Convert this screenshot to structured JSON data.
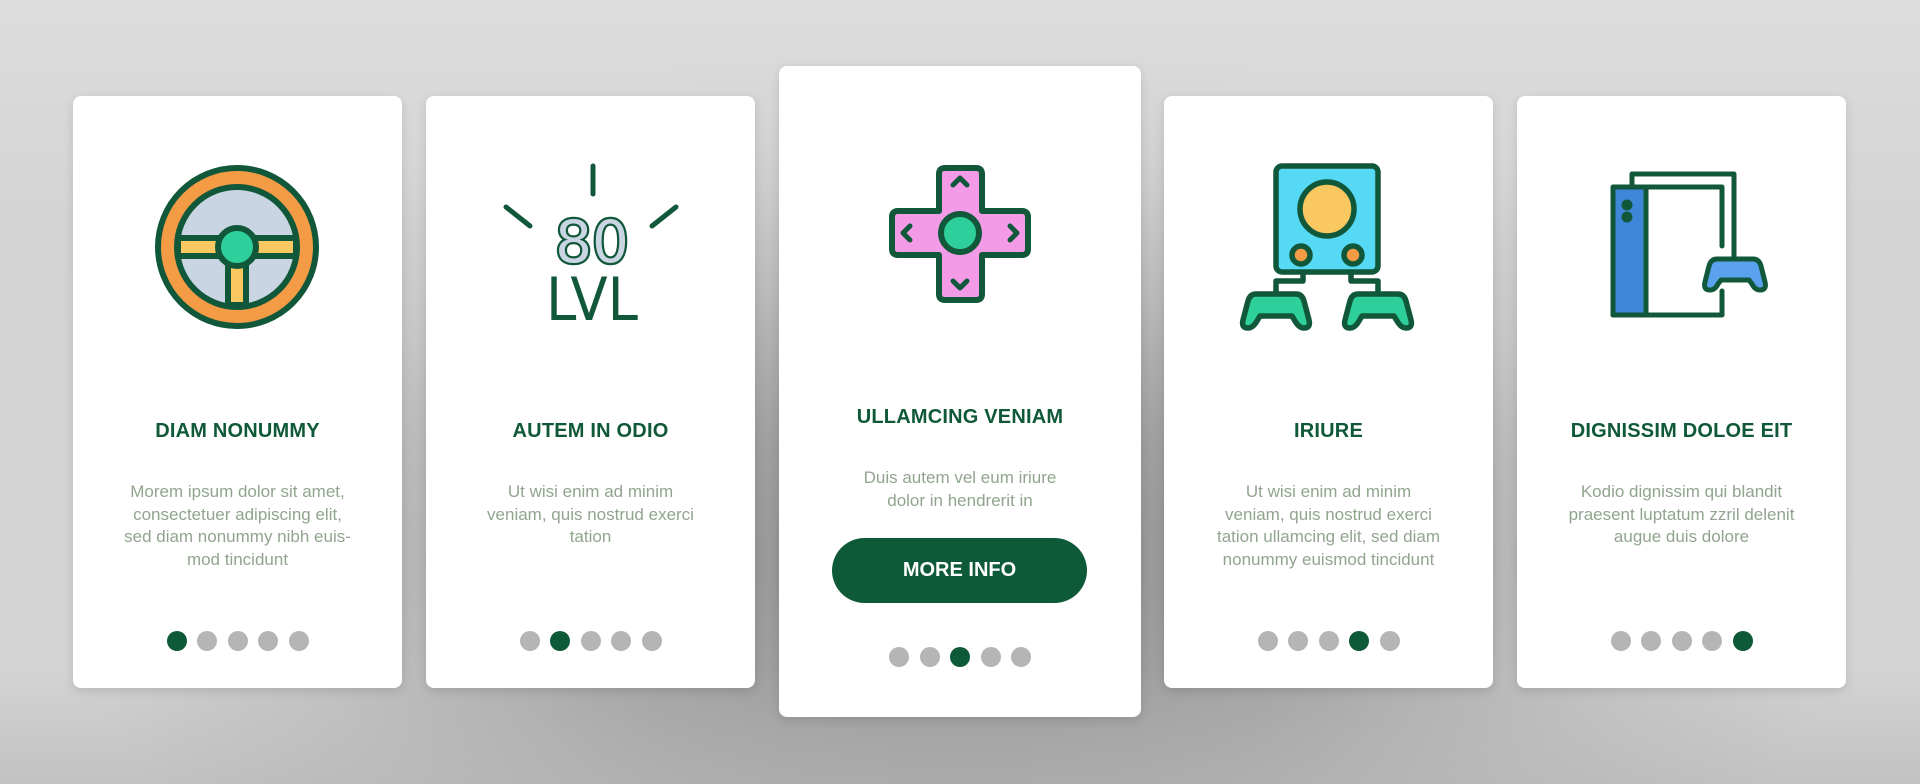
{
  "colors": {
    "primary": "#0e5a38",
    "description_text": "#91a58e",
    "dot_inactive": "#b5b5b5",
    "card_background": "#ffffff"
  },
  "cards": [
    {
      "icon": "steering-wheel-icon",
      "title": "DIAM NONUMMY",
      "description": "Morem ipsum dolor sit amet, consectetuer adipiscing elit, sed diam nonummy nibh euis-mod tincidunt",
      "description_lines": [
        "Morem ipsum dolor sit amet,",
        "consectetuer adipiscing elit,",
        "sed diam nonummy nibh euis-",
        "mod tincidunt"
      ],
      "active_dot": 1,
      "total_dots": 5
    },
    {
      "icon": "level-80-icon",
      "icon_text": {
        "number": "80",
        "label": "LVL"
      },
      "title": "AUTEM IN ODIO",
      "description_lines": [
        "Ut wisi enim ad minim",
        "veniam, quis nostrud exerci",
        "tation"
      ],
      "active_dot": 2,
      "total_dots": 5
    },
    {
      "icon": "d-pad-icon",
      "title": "ULLAMCING VENIAM",
      "description_lines": [
        "Duis autem vel eum iriure",
        "dolor in hendrerit in"
      ],
      "button_label": "MORE INFO",
      "active_dot": 3,
      "total_dots": 5
    },
    {
      "icon": "console-multiplayer-icon",
      "title": "IRIURE",
      "description_lines": [
        "Ut wisi enim ad minim",
        "veniam, quis nostrud exerci",
        "tation ullamcing elit, sed diam",
        "nonummy euismod tincidunt"
      ],
      "active_dot": 4,
      "total_dots": 5
    },
    {
      "icon": "game-console-controller-icon",
      "title": "DIGNISSIM DOLOE EIT",
      "description_lines": [
        "Kodio dignissim qui blandit",
        "praesent luptatum zzril delenit",
        "augue duis dolore"
      ],
      "active_dot": 5,
      "total_dots": 5
    }
  ]
}
